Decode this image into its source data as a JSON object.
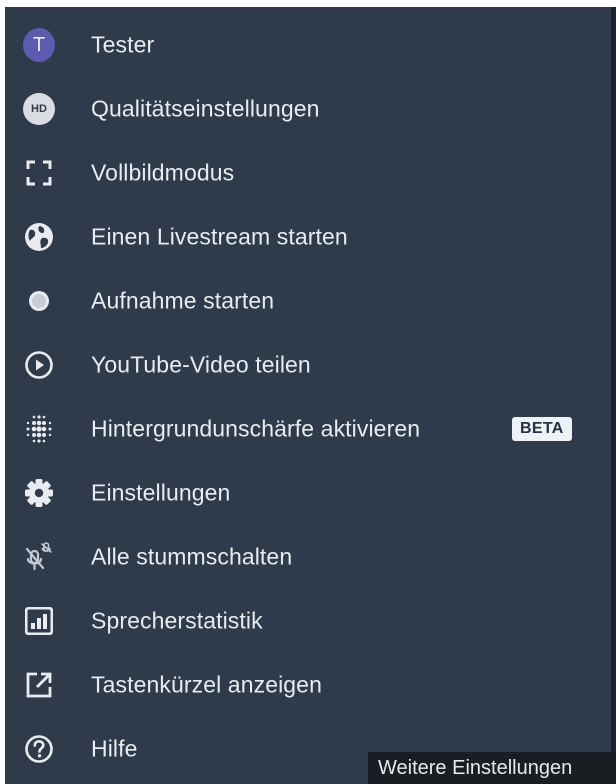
{
  "menu": {
    "items": [
      {
        "label": "Tester",
        "icon": "avatar-icon",
        "avatar_letter": "T"
      },
      {
        "label": "Qualitätseinstellungen",
        "icon": "hd-icon",
        "badge_text": "HD"
      },
      {
        "label": "Vollbildmodus",
        "icon": "fullscreen-icon"
      },
      {
        "label": "Einen Livestream starten",
        "icon": "globe-icon"
      },
      {
        "label": "Aufnahme starten",
        "icon": "record-icon"
      },
      {
        "label": "YouTube-Video teilen",
        "icon": "play-circle-icon"
      },
      {
        "label": "Hintergrundunschärfe aktivieren",
        "icon": "blur-dots-icon",
        "tag": "BETA"
      },
      {
        "label": "Einstellungen",
        "icon": "gear-icon"
      },
      {
        "label": "Alle stummschalten",
        "icon": "mute-all-icon"
      },
      {
        "label": "Sprecherstatistik",
        "icon": "speaker-stats-icon"
      },
      {
        "label": "Tastenkürzel anzeigen",
        "icon": "external-link-icon"
      },
      {
        "label": "Hilfe",
        "icon": "help-icon"
      }
    ]
  },
  "tooltip": {
    "text": "Weitere Einstellungen"
  },
  "colors": {
    "menu_background": "#2f3a4a",
    "text": "#e8ecf0",
    "avatar": "#5d5bb0",
    "tooltip_background": "#1a1d22"
  }
}
